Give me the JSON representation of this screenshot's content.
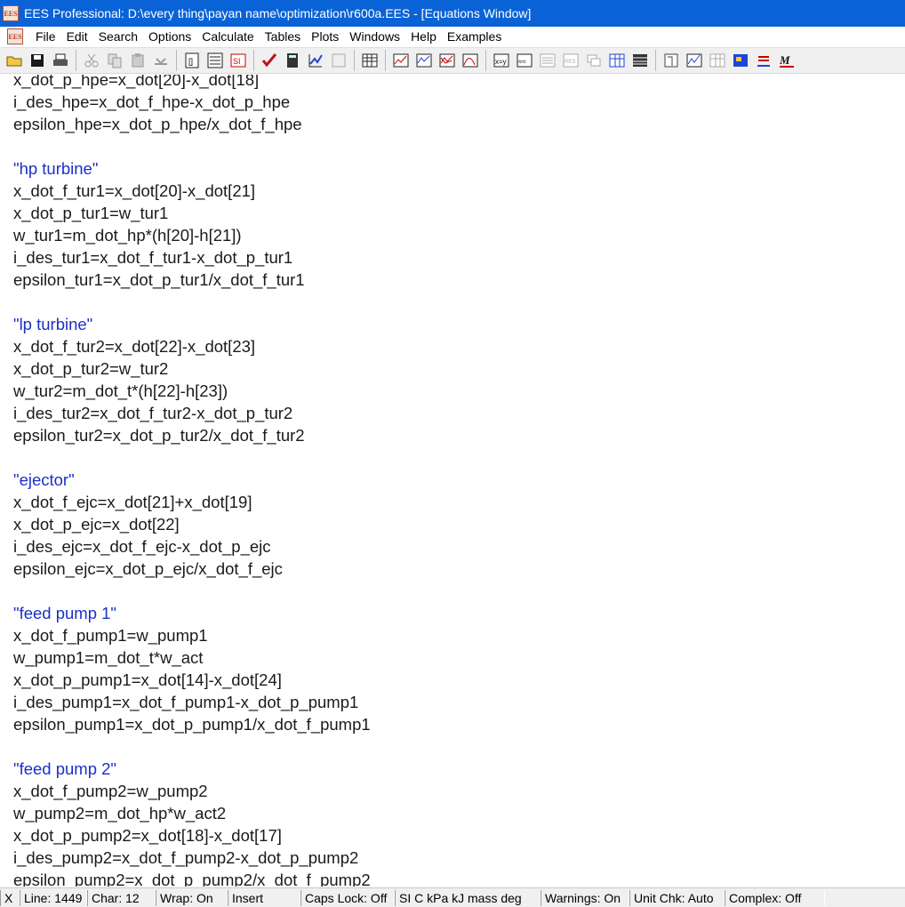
{
  "window": {
    "title": "EES Professional:  D:\\every thing\\payan name\\optimization\\r600a.EES - [Equations Window]",
    "app_icon_text": "EES"
  },
  "menu": [
    "File",
    "Edit",
    "Search",
    "Options",
    "Calculate",
    "Tables",
    "Plots",
    "Windows",
    "Help",
    "Examples"
  ],
  "toolbar": {
    "icons": [
      "open-folder-icon",
      "save-icon",
      "print-icon",
      "cut-icon",
      "copy-icon",
      "paste-icon",
      "undo-icon",
      "variable-info-icon",
      "equations-format-icon",
      "units-icon",
      "check-units-icon",
      "calculator-icon",
      "solve-icon",
      "plot-icon",
      "table-icon",
      "parametric-table-icon",
      "new-plot-icon",
      "overlay-plot-icon",
      "property-plot-icon",
      "plot-window-icon",
      "variable-assign-icon",
      "guess-values-icon",
      "text-icon",
      "ees-logo-icon",
      "diagram-icon",
      "array-icon",
      "lookup-table-icon",
      "integral-table-icon",
      "plot-window-2-icon",
      "plot-options-icon",
      "grid-icon",
      "picture-icon",
      "underline-icon",
      "macro-icon"
    ]
  },
  "editor": {
    "lines": [
      {
        "text": "x_dot_p_hpe=x_dot[20]-x_dot[18]",
        "kind": "code"
      },
      {
        "text": "i_des_hpe=x_dot_f_hpe-x_dot_p_hpe",
        "kind": "code"
      },
      {
        "text": "epsilon_hpe=x_dot_p_hpe/x_dot_f_hpe",
        "kind": "code"
      },
      {
        "text": "",
        "kind": "code"
      },
      {
        "text": "\"hp turbine\"",
        "kind": "comment"
      },
      {
        "text": "x_dot_f_tur1=x_dot[20]-x_dot[21]",
        "kind": "code"
      },
      {
        "text": "x_dot_p_tur1=w_tur1",
        "kind": "code"
      },
      {
        "text": "w_tur1=m_dot_hp*(h[20]-h[21])",
        "kind": "code"
      },
      {
        "text": "i_des_tur1=x_dot_f_tur1-x_dot_p_tur1",
        "kind": "code"
      },
      {
        "text": "epsilon_tur1=x_dot_p_tur1/x_dot_f_tur1",
        "kind": "code"
      },
      {
        "text": "",
        "kind": "code"
      },
      {
        "text": "\"lp turbine\"",
        "kind": "comment"
      },
      {
        "text": "x_dot_f_tur2=x_dot[22]-x_dot[23]",
        "kind": "code"
      },
      {
        "text": "x_dot_p_tur2=w_tur2",
        "kind": "code"
      },
      {
        "text": "w_tur2=m_dot_t*(h[22]-h[23])",
        "kind": "code"
      },
      {
        "text": "i_des_tur2=x_dot_f_tur2-x_dot_p_tur2",
        "kind": "code"
      },
      {
        "text": "epsilon_tur2=x_dot_p_tur2/x_dot_f_tur2",
        "kind": "code"
      },
      {
        "text": "",
        "kind": "code"
      },
      {
        "text": "\"ejector\"",
        "kind": "comment"
      },
      {
        "text": "x_dot_f_ejc=x_dot[21]+x_dot[19]",
        "kind": "code"
      },
      {
        "text": "x_dot_p_ejc=x_dot[22]",
        "kind": "code"
      },
      {
        "text": "i_des_ejc=x_dot_f_ejc-x_dot_p_ejc",
        "kind": "code"
      },
      {
        "text": "epsilon_ejc=x_dot_p_ejc/x_dot_f_ejc",
        "kind": "code"
      },
      {
        "text": "",
        "kind": "code"
      },
      {
        "text": "\"feed pump 1\"",
        "kind": "comment"
      },
      {
        "text": "x_dot_f_pump1=w_pump1",
        "kind": "code"
      },
      {
        "text": "w_pump1=m_dot_t*w_act",
        "kind": "code"
      },
      {
        "text": "x_dot_p_pump1=x_dot[14]-x_dot[24]",
        "kind": "code"
      },
      {
        "text": "i_des_pump1=x_dot_f_pump1-x_dot_p_pump1",
        "kind": "code"
      },
      {
        "text": "epsilon_pump1=x_dot_p_pump1/x_dot_f_pump1",
        "kind": "code"
      },
      {
        "text": "",
        "kind": "code"
      },
      {
        "text": "\"feed pump 2\"",
        "kind": "comment"
      },
      {
        "text": "x_dot_f_pump2=w_pump2",
        "kind": "code"
      },
      {
        "text": "w_pump2=m_dot_hp*w_act2",
        "kind": "code"
      },
      {
        "text": "x_dot_p_pump2=x_dot[18]-x_dot[17]",
        "kind": "code"
      },
      {
        "text": "i_des_pump2=x_dot_f_pump2-x_dot_p_pump2",
        "kind": "code"
      },
      {
        "text": "epsilon_pump2=x_dot_p_pump2/x_dot_f_pump2",
        "kind": "code"
      }
    ]
  },
  "status": [
    "X",
    "Line: 1449",
    "Char: 12",
    "Wrap: On",
    "Insert",
    "Caps Lock: Off",
    "SI C kPa kJ mass deg",
    "Warnings: On",
    "Unit Chk: Auto",
    "Complex: Off"
  ],
  "colors": {
    "titlebar": "#0a63d6",
    "comment": "#1c2fc9",
    "code": "#1a1a1a"
  }
}
